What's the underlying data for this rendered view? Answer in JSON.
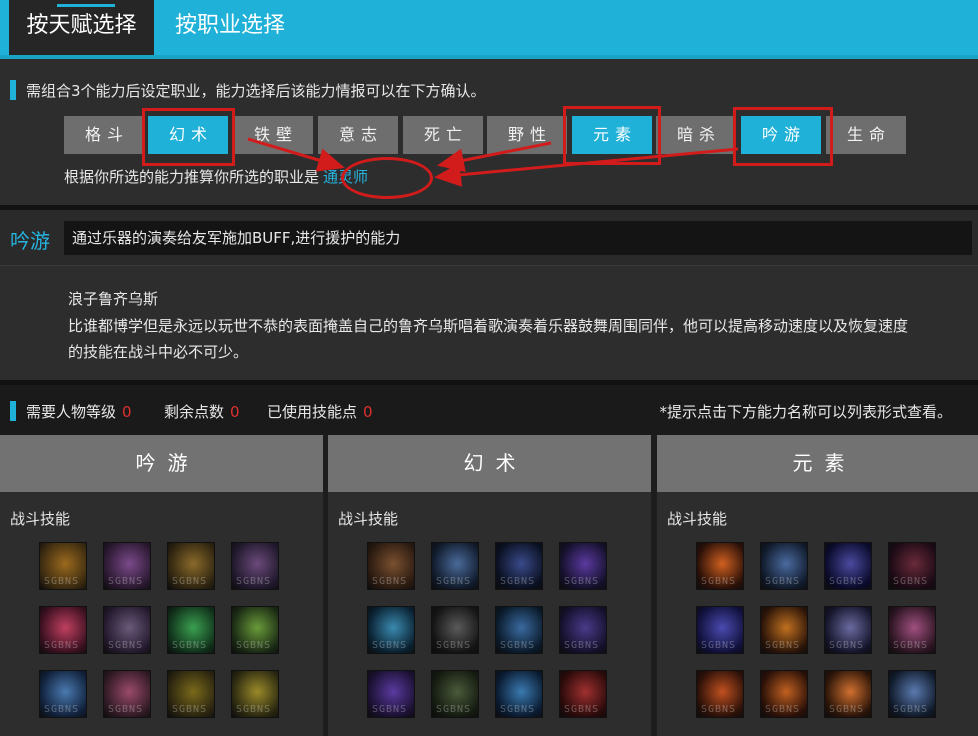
{
  "tabs": {
    "active": "按天赋选择",
    "other": "按职业选择"
  },
  "talent_section": {
    "hint": "需组合3个能力后设定职业，能力选择后该能力情报可以在下方确认。",
    "talents": [
      {
        "label": "格斗",
        "selected": false
      },
      {
        "label": "幻术",
        "selected": true
      },
      {
        "label": "铁壁",
        "selected": false
      },
      {
        "label": "意志",
        "selected": false
      },
      {
        "label": "死亡",
        "selected": false
      },
      {
        "label": "野性",
        "selected": false
      },
      {
        "label": "元素",
        "selected": true
      },
      {
        "label": "暗杀",
        "selected": false
      },
      {
        "label": "吟游",
        "selected": true
      },
      {
        "label": "生命",
        "selected": false
      }
    ],
    "result_prefix": "根据你所选的能力推算你所选的职业是",
    "result_job": "通灵师"
  },
  "ability_info": {
    "name": "吟游",
    "summary": "通过乐器的演奏给友军施加BUFF,进行援护的能力",
    "character": "浪子鲁齐乌斯",
    "description": "比谁都博学但是永远以玩世不恭的表面掩盖自己的鲁齐乌斯唱着歌演奏着乐器鼓舞周围同伴，他可以提高移动速度以及恢复速度的技能在战斗中必不可少。"
  },
  "stats": {
    "level_label": "需要人物等级",
    "level_value": "0",
    "remaining_label": "剩余点数",
    "remaining_value": "0",
    "used_label": "已使用技能点",
    "used_value": "0",
    "tip": "*提示点击下方能力名称可以列表形式查看。"
  },
  "columns": [
    {
      "title": "吟游",
      "category": "战斗技能"
    },
    {
      "title": "幻术",
      "category": "战斗技能"
    },
    {
      "title": "元素",
      "category": "战斗技能"
    }
  ],
  "icon_watermark": "SGBNS",
  "colors": {
    "accent": "#1fb1d8",
    "highlight": "#d21b1b",
    "job_link": "#26b4e0"
  }
}
